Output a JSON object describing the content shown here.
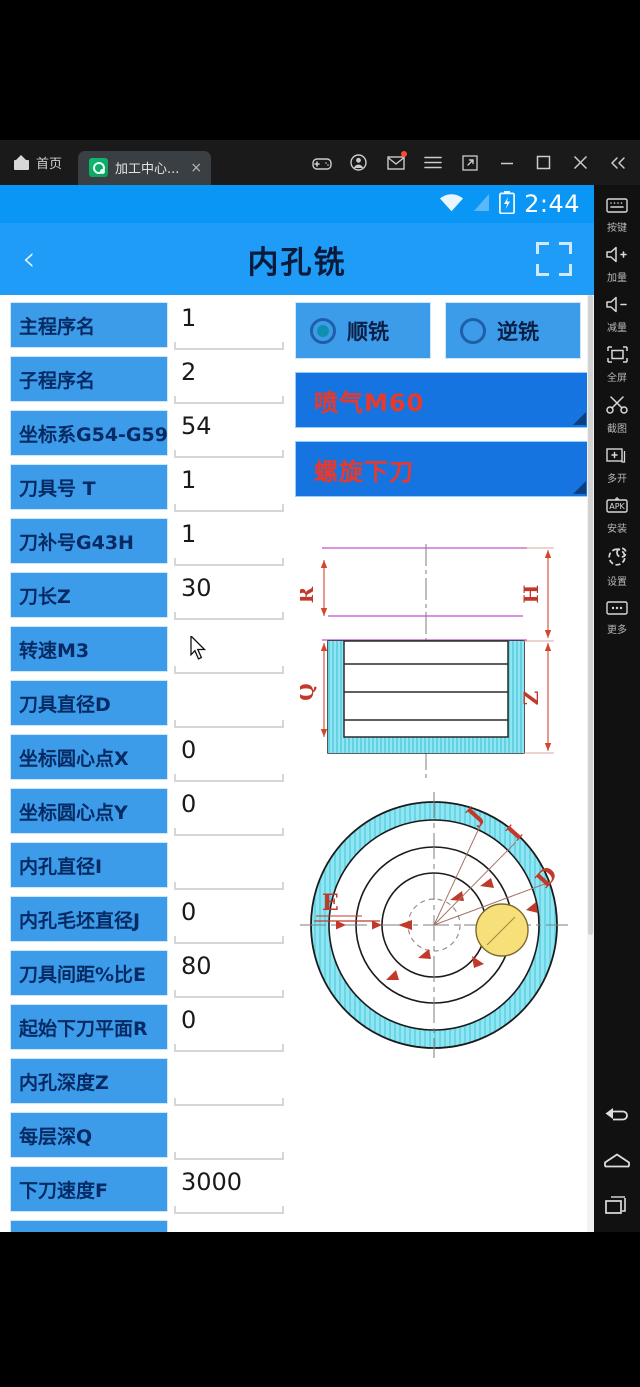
{
  "emulator": {
    "home_tab_label": "首页",
    "home_icon": "home-icon",
    "app_tab_label": "加工中心...",
    "app_tab_close": "×",
    "window_tools": [
      {
        "name": "gamepad-icon",
        "label": "gamepad"
      },
      {
        "name": "account-icon",
        "label": "account"
      },
      {
        "name": "mail-icon",
        "label": "mail"
      },
      {
        "name": "menu-icon",
        "label": "menu"
      },
      {
        "name": "resize-icon",
        "label": "resize"
      },
      {
        "name": "minimize-icon",
        "label": "minimize"
      },
      {
        "name": "maximize-icon",
        "label": "maximize"
      },
      {
        "name": "close-icon",
        "label": "close"
      },
      {
        "name": "collapse-icon",
        "label": "collapse"
      }
    ]
  },
  "statusbar": {
    "time": "2:44",
    "wifi_icon": "wifi-icon",
    "signal_icon": "signal-icon",
    "battery_icon": "battery-icon"
  },
  "appbar": {
    "back_icon": "back-chevron-icon",
    "title": "内孔铣",
    "scan_icon": "scan-frame-icon"
  },
  "form": {
    "fields": [
      {
        "label": "主程序名",
        "value": "1"
      },
      {
        "label": "子程序名",
        "value": "2"
      },
      {
        "label": "坐标系G54-G59",
        "value": "54"
      },
      {
        "label": "刀具号 T",
        "value": "1"
      },
      {
        "label": "刀补号G43H",
        "value": "1"
      },
      {
        "label": "刀长Z",
        "value": "30"
      },
      {
        "label": "转速M3",
        "value": ""
      },
      {
        "label": "刀具直径D",
        "value": ""
      },
      {
        "label": "坐标圆心点X",
        "value": "0"
      },
      {
        "label": "坐标圆心点Y",
        "value": "0"
      },
      {
        "label": "内孔直径I",
        "value": ""
      },
      {
        "label": "内孔毛坯直径J",
        "value": "0"
      },
      {
        "label": "刀具间距%比E",
        "value": "80"
      },
      {
        "label": "起始下刀平面R",
        "value": "0"
      },
      {
        "label": "内孔深度Z",
        "value": ""
      },
      {
        "label": "每层深Q",
        "value": ""
      },
      {
        "label": "下刀速度F",
        "value": "3000"
      },
      {
        "label": "",
        "value": ""
      }
    ]
  },
  "options": {
    "radios": [
      {
        "label": "顺铣",
        "selected": true
      },
      {
        "label": "逆铣",
        "selected": false
      }
    ],
    "dropdowns": [
      {
        "label": "喷气M60"
      },
      {
        "label": "螺旋下刀"
      }
    ]
  },
  "diagrams": {
    "section_view": {
      "name": "cross-section-diagram",
      "dimension_labels": [
        "R",
        "Q",
        "H",
        "Z"
      ]
    },
    "top_view": {
      "name": "top-view-diagram",
      "dimension_labels": [
        "E",
        "J",
        "I",
        "D"
      ]
    }
  },
  "sidebar": {
    "items": [
      {
        "icon": "keyboard-icon",
        "label": "按键"
      },
      {
        "icon": "volume-up-icon",
        "label": "加量"
      },
      {
        "icon": "volume-down-icon",
        "label": "减量"
      },
      {
        "icon": "fullscreen-icon",
        "label": "全屏"
      },
      {
        "icon": "scissors-icon",
        "label": "截图"
      },
      {
        "icon": "multi-window-icon",
        "label": "多开"
      },
      {
        "icon": "apk-icon",
        "label": "安装"
      },
      {
        "icon": "settings-icon",
        "label": "设置"
      },
      {
        "icon": "more-icon",
        "label": "更多"
      }
    ],
    "nav": [
      {
        "icon": "android-back-icon"
      },
      {
        "icon": "android-home-icon"
      },
      {
        "icon": "android-recents-icon"
      }
    ]
  },
  "colors": {
    "appbar_blue": "#1e9cf7",
    "status_blue": "#0a96f5",
    "label_blue": "#3d9ce9",
    "dropdown_blue": "#1574e0",
    "dropdown_text_red": "#e8392c",
    "label_text": "#062a63"
  }
}
